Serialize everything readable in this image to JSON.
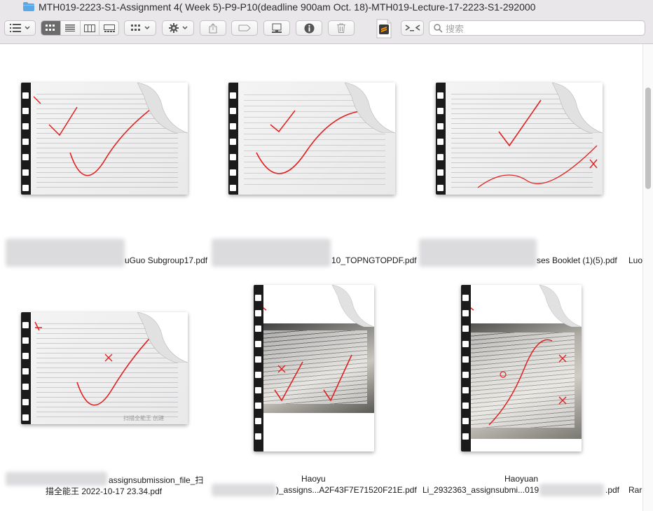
{
  "window": {
    "title": "MTH019-2223-S1-Assignment 4( Week 5)-P9-P10(deadline 900am Oct. 18)-MTH019-Lecture-17-2223-S1-292000",
    "folder_icon": "folder-icon"
  },
  "toolbar": {
    "buttons": [
      {
        "name": "list-options-button",
        "icon": "list-icon"
      },
      {
        "name": "view-icon-button",
        "icon": "grid-icon",
        "active": true
      },
      {
        "name": "view-list-button",
        "icon": "lines-icon"
      },
      {
        "name": "view-column-button",
        "icon": "columns-icon"
      },
      {
        "name": "view-gallery-button",
        "icon": "gallery-icon"
      },
      {
        "name": "group-button",
        "icon": "grid-icon"
      },
      {
        "name": "action-button",
        "icon": "gear-icon"
      },
      {
        "name": "share-button",
        "icon": "share-icon"
      },
      {
        "name": "tag-button",
        "icon": "tag-icon"
      },
      {
        "name": "connect-button",
        "icon": "computer-icon"
      },
      {
        "name": "info-button",
        "icon": "info-icon"
      },
      {
        "name": "trash-button",
        "icon": "trash-icon"
      },
      {
        "name": "sublime-button",
        "icon": "sublime-text-icon"
      },
      {
        "name": "terminal-button",
        "icon": "terminal-icon"
      }
    ],
    "search_placeholder": "搜索"
  },
  "files": [
    {
      "name": "uGuo Subgroup17.pdf",
      "type": "landscape-pdf"
    },
    {
      "name": "10_TOPNGTOPDF.pdf",
      "type": "landscape-pdf"
    },
    {
      "name": "ses Booklet (1)(5).pdf",
      "type": "landscape-pdf"
    },
    {
      "name_line1": "assignsubmission_file_扫",
      "name_line2": "描全能王 2022-10-17 23.34.pdf",
      "watermark": "扫描全能王 创建",
      "type": "landscape-pdf"
    },
    {
      "name_line1": "Haoyu",
      "name_line2": ")_assigns...A2F43F7E71520F21E.pdf",
      "type": "portrait-photo"
    },
    {
      "name_line1": "Haoyuan",
      "name_line2a": "Li_2932363_assignsubmi...019",
      "name_line2b": ".pdf",
      "type": "portrait-photo"
    }
  ],
  "edge_cut": {
    "row1": "Luo",
    "row2": "Rar"
  },
  "colors": {
    "accent_folder": "#5aa8e8",
    "active_segment": "#6d6c6d",
    "ink_red": "#e02020"
  }
}
